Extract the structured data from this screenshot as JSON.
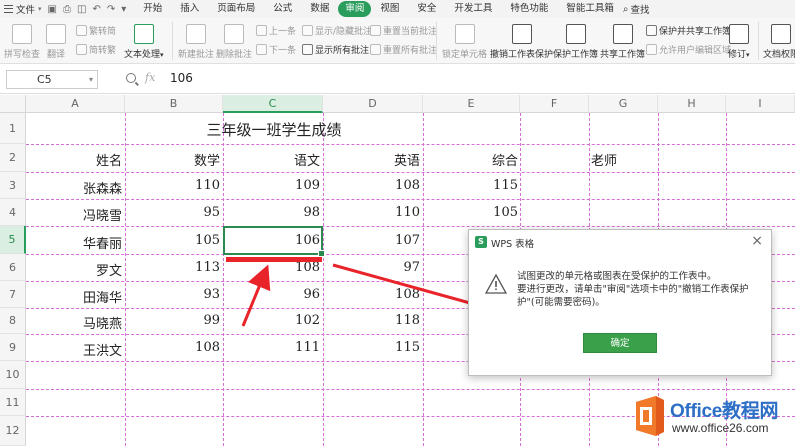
{
  "tabs": {
    "file": "文件",
    "items": [
      "开始",
      "插入",
      "页面布局",
      "公式",
      "数据",
      "审阅",
      "视图",
      "安全",
      "开发工具",
      "特色功能",
      "智能工具箱"
    ],
    "active": "审阅",
    "search": "查找"
  },
  "ribbon": {
    "spell_check": "拼写检查",
    "translate": "翻译",
    "simp_to_trad": "繁转简",
    "trad_to_simp": "简转繁",
    "text_processing": "文本处理",
    "new_comment": "新建批注",
    "delete_comment": "删除批注",
    "prev": "上一条",
    "next": "下一条",
    "show_hide_comment": "显示/隐藏批注",
    "show_all_comments": "显示所有批注",
    "reset_current_comment": "重置当前批注",
    "reset_all_comments": "重置所有批注",
    "lock_cells": "锁定单元格",
    "unprotect_sheet": "撤销工作表保护",
    "protect_workbook": "保护工作簿",
    "share_workbook": "共享工作簿",
    "protect_share_workbook": "保护并共享工作簿",
    "allow_edit_ranges": "允许用户编辑区域",
    "revise": "修订",
    "doc_permission": "文档权限"
  },
  "formula_bar": {
    "cell_ref": "C5",
    "fx": "fx",
    "value": "106"
  },
  "columns": [
    "A",
    "B",
    "C",
    "D",
    "E",
    "F",
    "G",
    "H",
    "I"
  ],
  "rows": [
    "1",
    "2",
    "3",
    "4",
    "5",
    "6",
    "7",
    "8",
    "9",
    "10",
    "11",
    "12"
  ],
  "sheet": {
    "title": "三年级一班学生成绩",
    "headers": [
      "姓名",
      "数学",
      "语文",
      "英语",
      "综合",
      "老师"
    ],
    "students": [
      {
        "name": "张森森",
        "math": "110",
        "chinese": "109",
        "english": "108",
        "total": "115"
      },
      {
        "name": "冯晓雪",
        "math": "95",
        "chinese": "98",
        "english": "110",
        "total": "105"
      },
      {
        "name": "华春丽",
        "math": "105",
        "chinese": "106",
        "english": "107",
        "total": ""
      },
      {
        "name": "罗文",
        "math": "113",
        "chinese": "108",
        "english": "97",
        "total": ""
      },
      {
        "name": "田海华",
        "math": "93",
        "chinese": "96",
        "english": "108",
        "total": ""
      },
      {
        "name": "马晓燕",
        "math": "99",
        "chinese": "102",
        "english": "118",
        "total": ""
      },
      {
        "name": "王洪文",
        "math": "108",
        "chinese": "111",
        "english": "115",
        "total": ""
      }
    ]
  },
  "dialog": {
    "title": "WPS 表格",
    "line1": "试图更改的单元格或图表在受保护的工作表中。",
    "line2": "要进行更改，请单击\"审阅\"选项卡中的\"撤销工作表保护",
    "line3": "护\"(可能需要密码)。",
    "ok": "确定"
  },
  "watermark": {
    "brand": "Office教程网",
    "url": "www.office26.com"
  },
  "colors": {
    "accent": "#2a9d5c",
    "annotation_red": "#e8232a",
    "gridline": "#d76ed7"
  }
}
